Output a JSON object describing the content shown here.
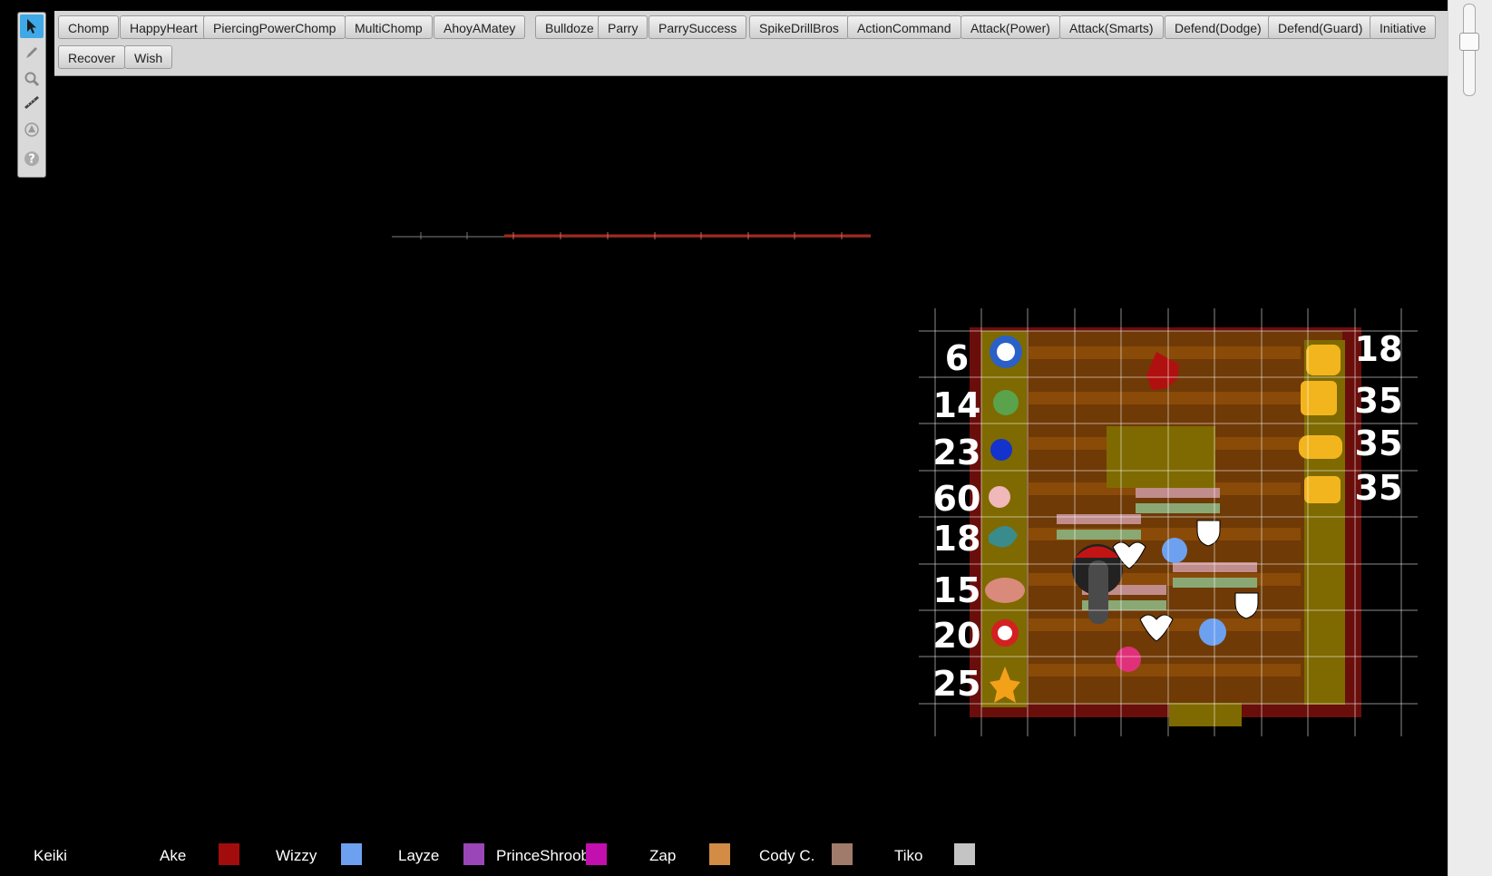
{
  "toolbar": {
    "tools": [
      {
        "name": "select-tool-icon",
        "active": true
      },
      {
        "name": "draw-tool-icon",
        "active": false
      },
      {
        "name": "zoom-tool-icon",
        "active": false
      },
      {
        "name": "measure-ruler-icon",
        "active": false
      },
      {
        "name": "fog-tool-icon",
        "active": false
      },
      {
        "name": "help-icon",
        "active": false
      }
    ]
  },
  "macros": [
    "Chomp",
    "HappyHeart",
    "PiercingPowerChomp",
    "MultiChomp",
    "AhoyAMatey",
    "Bulldoze",
    "Parry",
    "ParrySuccess",
    "SpikeDrillBros",
    "ActionCommand",
    "Attack(Power)",
    "Attack(Smarts)",
    "Defend(Dodge)",
    "Defend(Guard)",
    "Initiative",
    "Recover",
    "Wish"
  ],
  "map": {
    "left_numbers": [
      "6",
      "14",
      "23",
      "60",
      "18",
      "15",
      "20",
      "25"
    ],
    "right_numbers": [
      "18",
      "35",
      "35",
      "35"
    ]
  },
  "players": [
    {
      "name": "Keiki",
      "color": null
    },
    {
      "name": "Ake",
      "color": "#a30c0c"
    },
    {
      "name": "Wizzy",
      "color": "#6da1f0"
    },
    {
      "name": "Layze",
      "color": "#9b46b8"
    },
    {
      "name": "PrinceShroob",
      "color": "#c20fae"
    },
    {
      "name": "Zap",
      "color": "#d28c45"
    },
    {
      "name": "Cody C.",
      "color": "#a07a6a"
    },
    {
      "name": "Tiko",
      "color": "#c4c4c4"
    }
  ],
  "colors": {
    "map_floor": "#6f3a06",
    "map_border": "#6a0e0b",
    "highlight": "#7e6a00",
    "grid": "#ffffff"
  }
}
